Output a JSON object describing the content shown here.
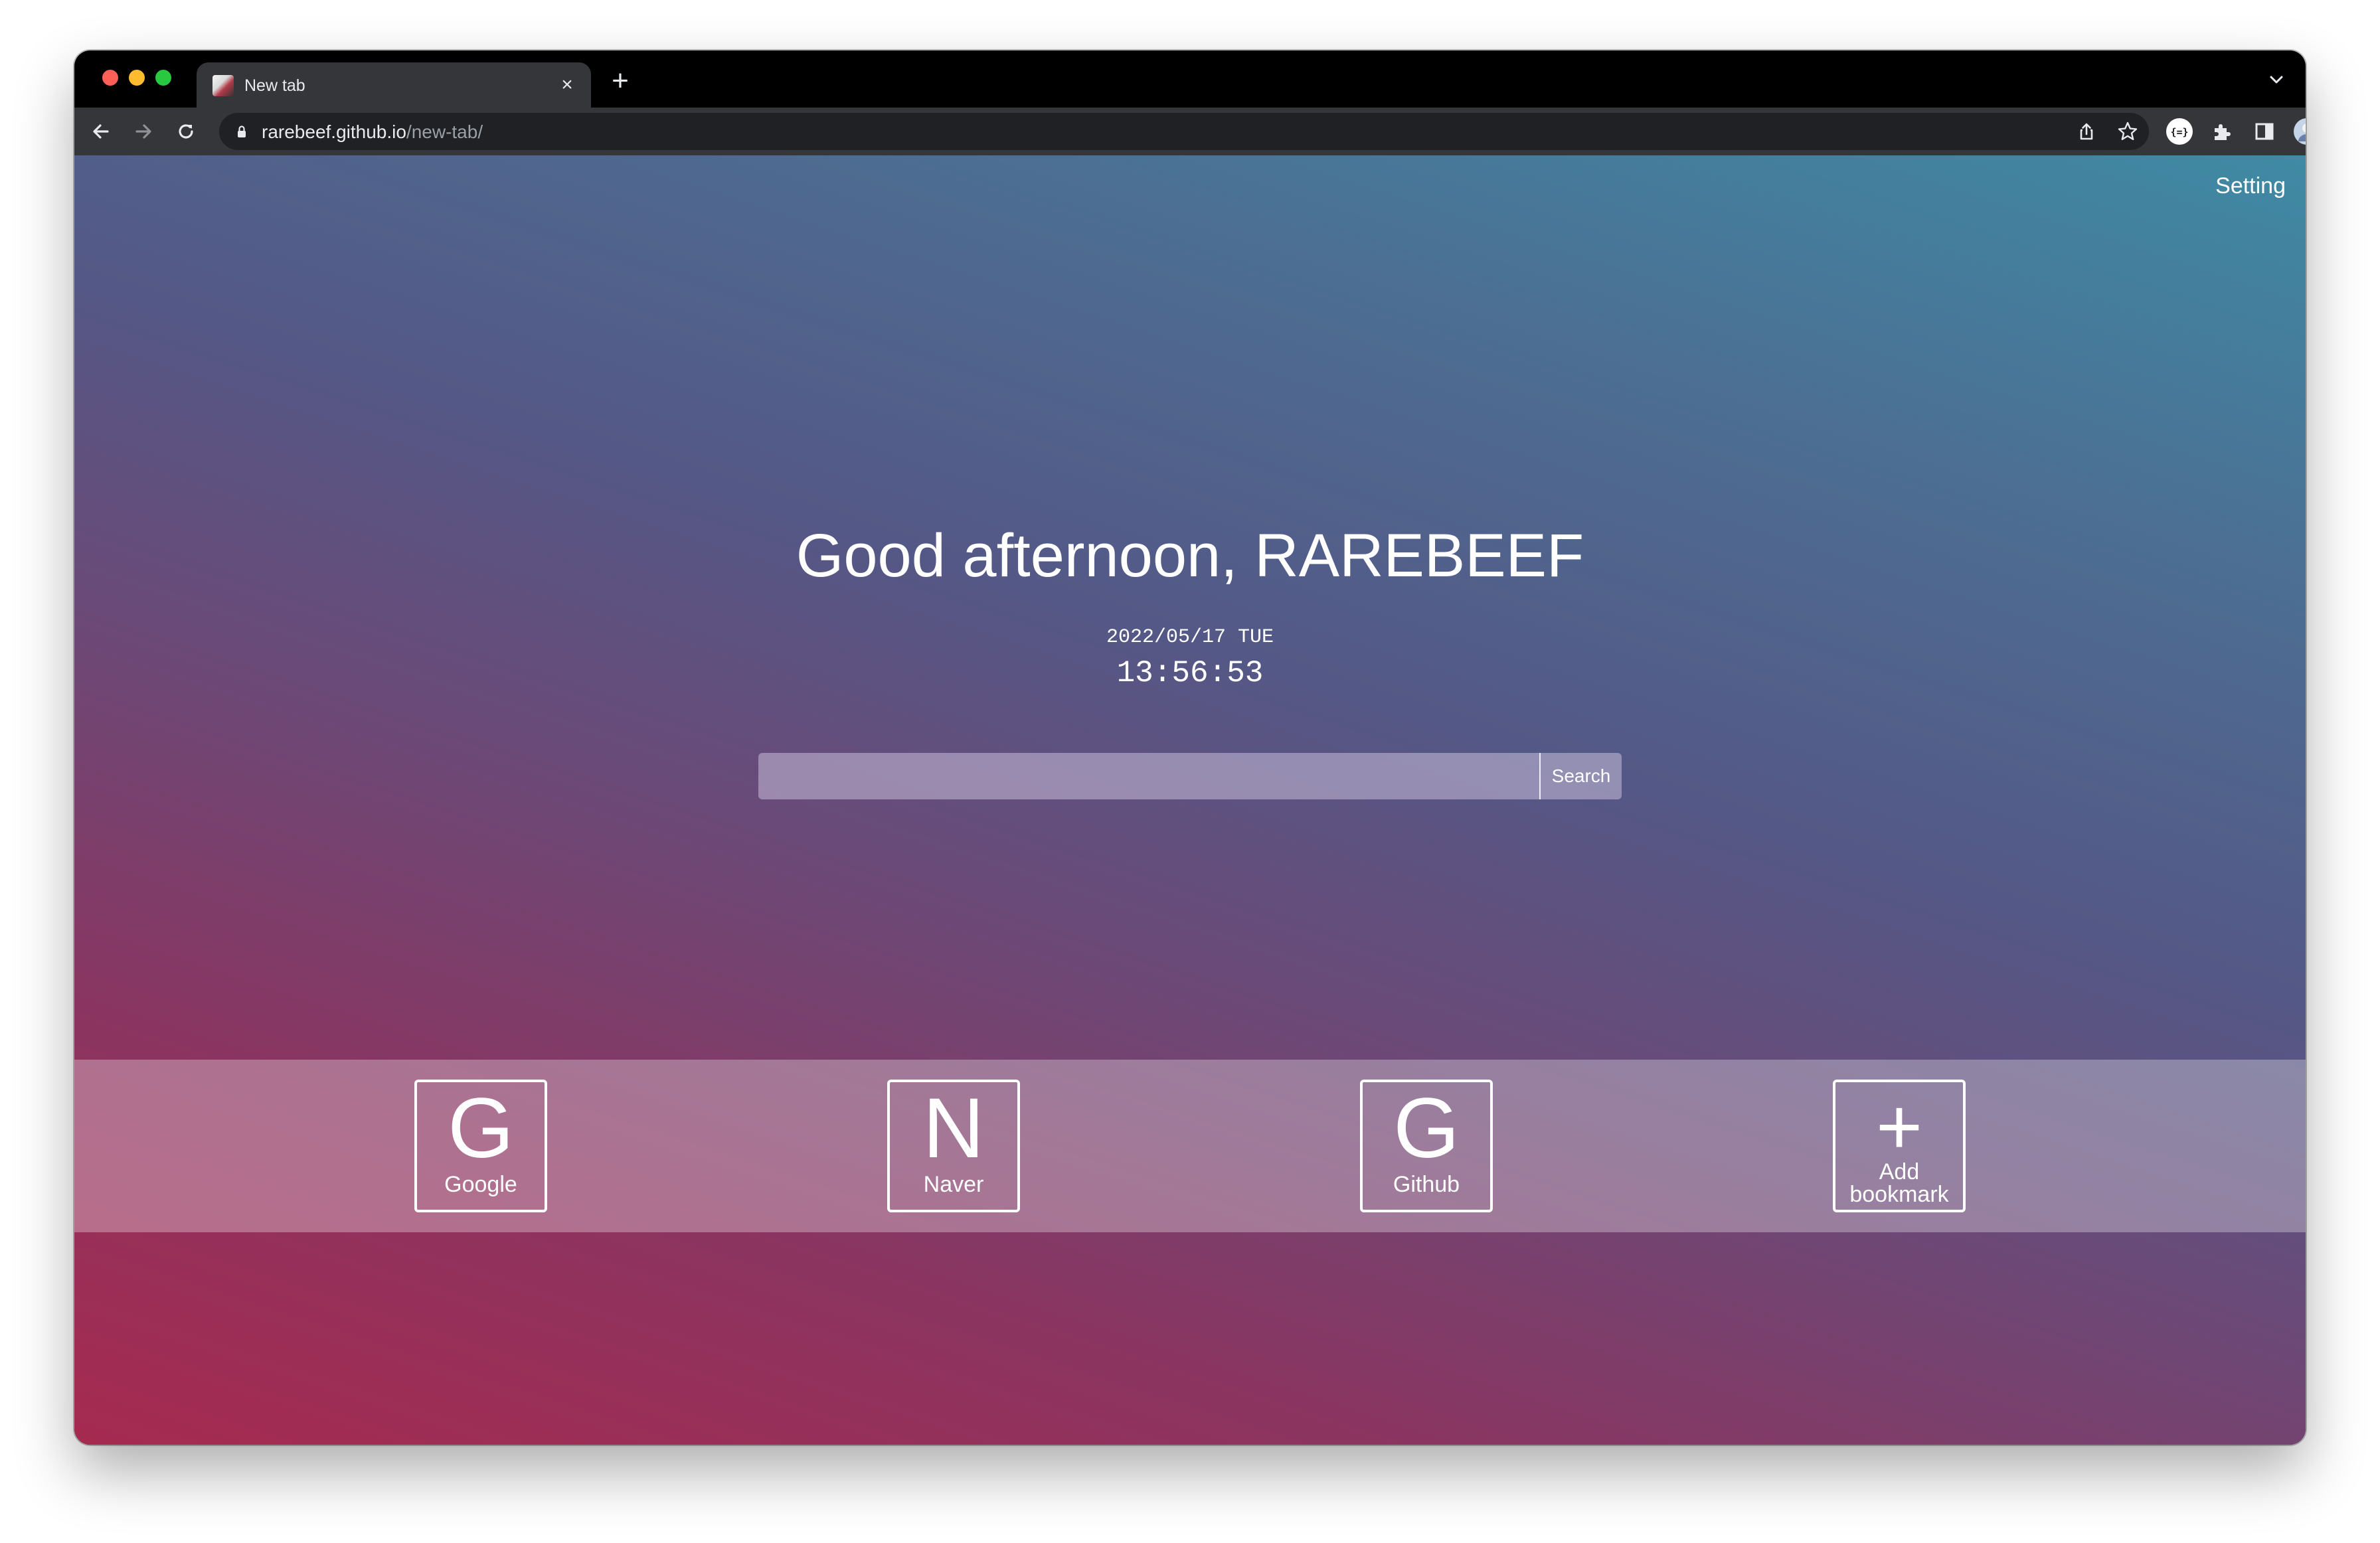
{
  "browser": {
    "tab": {
      "title": "New tab",
      "close_glyph": "×",
      "favicon": "site-favicon"
    },
    "new_tab_glyph": "+",
    "address_bar": {
      "domain": "rarebeef.github.io",
      "path": "/new-tab/"
    },
    "icons": {
      "back": "back-arrow-icon",
      "forward": "forward-arrow-icon",
      "reload": "reload-icon",
      "lock": "lock-icon",
      "share": "share-icon",
      "bookmark_star": "star-icon",
      "extension_badge": "extension-icon",
      "extensions": "puzzle-icon",
      "side_panel": "side-panel-icon",
      "profile": "avatar",
      "menu": "kebab-menu-icon",
      "tab_search": "chevron-down-icon"
    },
    "traffic_light_colors": [
      "#fe5f57",
      "#febc2e",
      "#28c840"
    ]
  },
  "page": {
    "setting_label": "Setting",
    "greeting": "Good afternoon, RAREBEEF",
    "date": "2022/05/17 TUE",
    "time": "13:56:53",
    "search": {
      "placeholder": "",
      "value": "",
      "button_label": "Search"
    },
    "bookmarks": [
      {
        "letter": "G",
        "label": "Google"
      },
      {
        "letter": "N",
        "label": "Naver"
      },
      {
        "letter": "G",
        "label": "Github"
      }
    ],
    "add_bookmark": {
      "glyph": "+",
      "label_line1": "Add",
      "label_line2": "bookmark"
    },
    "gradient_colors": [
      "#a62a50",
      "#6a4a78",
      "#3f8aa4"
    ]
  }
}
